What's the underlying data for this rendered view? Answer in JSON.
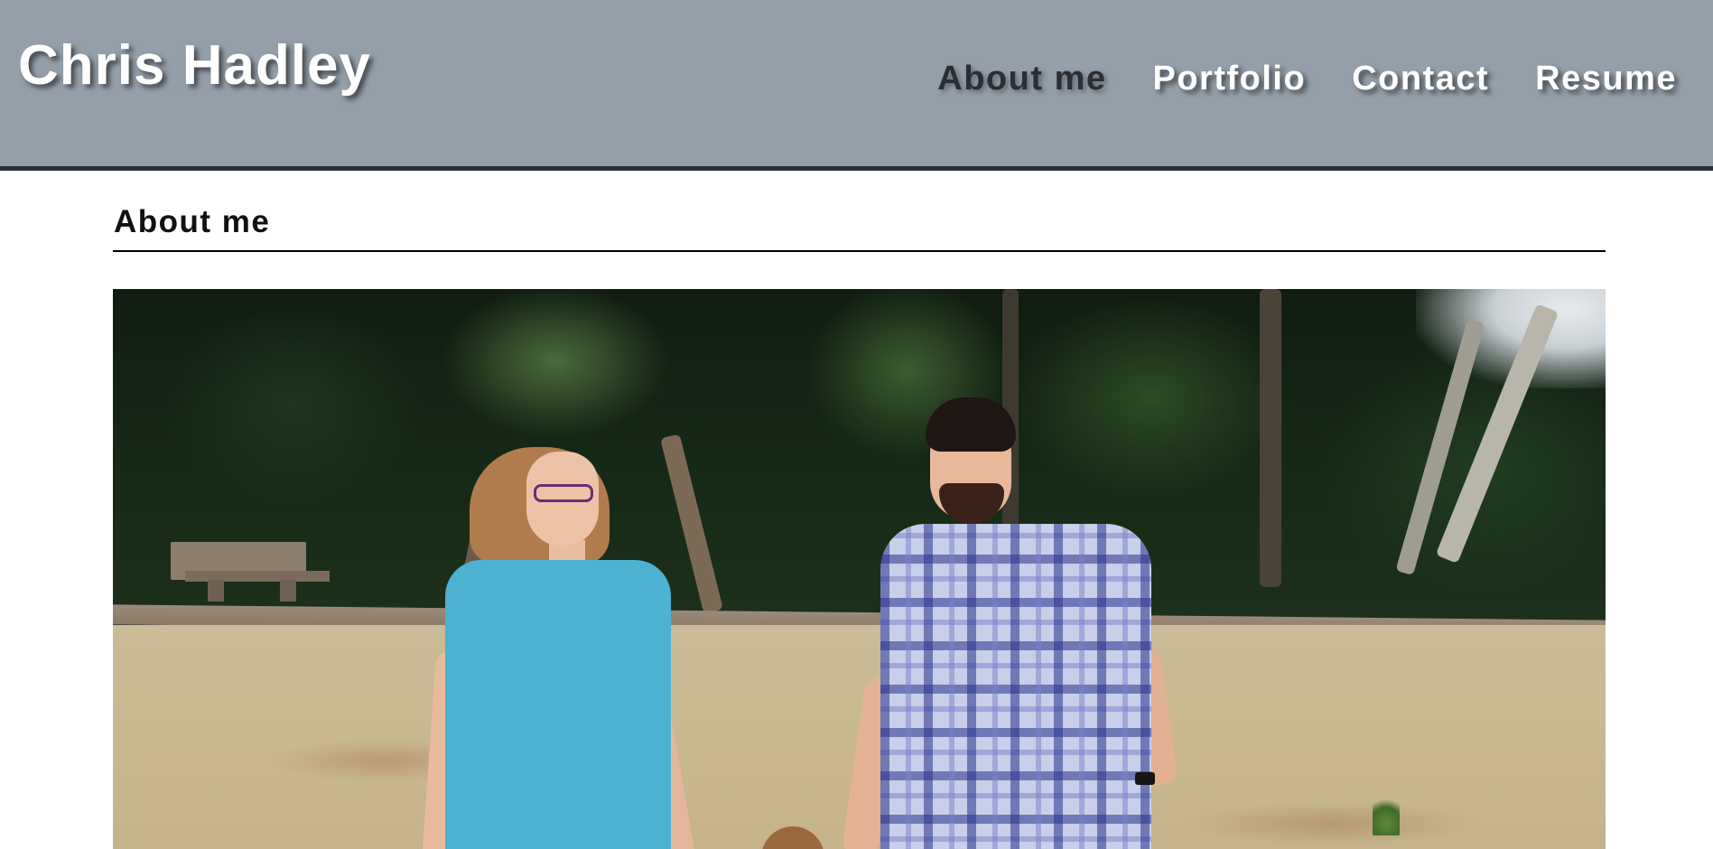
{
  "header": {
    "site_title": "Chris Hadley",
    "nav": [
      {
        "label": "About me",
        "active": true
      },
      {
        "label": "Portfolio",
        "active": false
      },
      {
        "label": "Contact",
        "active": false
      },
      {
        "label": "Resume",
        "active": false
      }
    ]
  },
  "main": {
    "section_heading": "About me",
    "photo": {
      "icon": "family-photo"
    }
  },
  "colors": {
    "header_bg": "#959fa9",
    "header_border": "#2c3038",
    "active_nav": "#2a2e35",
    "nav_text": "#ffffff",
    "heading_text": "#111111"
  }
}
